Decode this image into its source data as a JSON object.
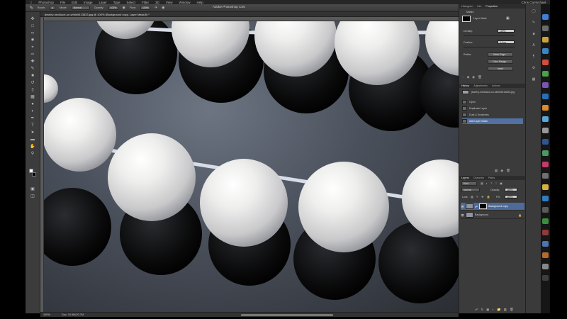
{
  "menubar": {
    "app": "Photoshop",
    "items": [
      "File",
      "Edit",
      "Image",
      "Layer",
      "Type",
      "Select",
      "Filter",
      "3D",
      "View",
      "Window",
      "Help"
    ],
    "right_user": "Chris Carmichael"
  },
  "title": "Adobe Photoshop CS6",
  "options": {
    "brush_label": "Brush:",
    "mode_label": "Mode:",
    "mode_value": "Normal",
    "opacity_label": "Opacity:",
    "opacity_value": "100%",
    "flow_label": "Flow:",
    "flow_value": "100%"
  },
  "document": {
    "tab_title": "jewelry-necklace-on-white5413833.jpg @ 100% (Background copy, Layer Mask/8) *",
    "zoom": "100%",
    "doc_info": "Doc: 10.9M/20.7M"
  },
  "panels": {
    "top_tabs": [
      "Histogram",
      "Info",
      "Properties"
    ],
    "active_top_tab": "Properties",
    "masks_label": "Masks",
    "layer_mask_label": "Layer Mask",
    "density_label": "Density:",
    "density_value": "100%",
    "feather_label": "Feather:",
    "feather_value": "0.0 px",
    "refine_label": "Refine:",
    "mask_edge_button": "Mask Edge...",
    "color_range_button": "Color Range...",
    "invert_button": "Invert",
    "history_tabs": [
      "History",
      "Adjustments",
      "Actions"
    ],
    "history_items": [
      {
        "label": "jewelry-necklace-on-white5413833.jpg",
        "selected": false
      },
      {
        "label": "Open",
        "selected": false
      },
      {
        "label": "Duplicate Layer",
        "selected": false
      },
      {
        "label": "Dust & Scratches",
        "selected": false
      },
      {
        "label": "Add Layer Mask",
        "selected": true
      }
    ],
    "layers_tabs": [
      "Layers",
      "Channels",
      "Paths"
    ],
    "kind_label": "Kind",
    "blend_mode": "Normal",
    "opacity_label": "Opacity:",
    "opacity_value": "100%",
    "lock_label": "Lock:",
    "fill_label": "Fill:",
    "fill_value": "100%",
    "layers": [
      {
        "name": "Background copy",
        "selected": true,
        "mask": true
      },
      {
        "name": "Background",
        "selected": false,
        "mask": false
      }
    ]
  }
}
